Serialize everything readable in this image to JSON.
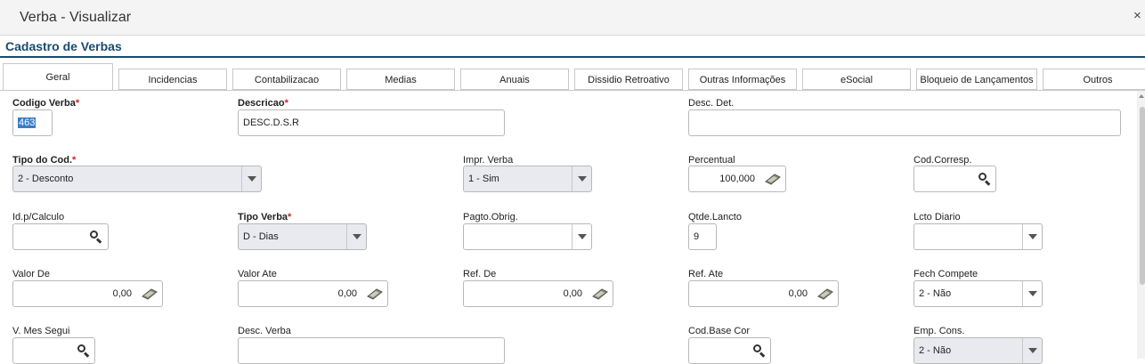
{
  "window": {
    "title": "Verba - Visualizar",
    "close_glyph": "×"
  },
  "form_title": "Cadastro de Verbas",
  "tabs": [
    "Geral",
    "Incidencias",
    "Contabilizacao",
    "Medias",
    "Anuais",
    "Dissidio Retroativo",
    "Outras Informações",
    "eSocial",
    "Bloqueio de Lançamentos",
    "Outros"
  ],
  "required_mark": "*",
  "fields": {
    "codigo_verba": {
      "label": "Codigo Verba",
      "value": "463"
    },
    "descricao": {
      "label": "Descricao",
      "value": "DESC.D.S.R"
    },
    "desc_det": {
      "label": "Desc. Det.",
      "value": ""
    },
    "tipo_cod": {
      "label": "Tipo do Cod.",
      "value": "2 - Desconto"
    },
    "impr_verba": {
      "label": "Impr. Verba",
      "value": "1 - Sim"
    },
    "percentual": {
      "label": "Percentual",
      "value": "100,000"
    },
    "cod_corresp": {
      "label": "Cod.Corresp.",
      "value": ""
    },
    "id_calculo": {
      "label": "Id.p/Calculo",
      "value": ""
    },
    "tipo_verba": {
      "label": "Tipo Verba",
      "value": "D - Dias"
    },
    "pagto_obrig": {
      "label": "Pagto.Obrig.",
      "value": ""
    },
    "qtde_lancto": {
      "label": "Qtde.Lancto",
      "value": "9"
    },
    "lcto_diario": {
      "label": "Lcto Diario",
      "value": ""
    },
    "valor_de": {
      "label": "Valor De",
      "value": "0,00"
    },
    "valor_ate": {
      "label": "Valor Ate",
      "value": "0,00"
    },
    "ref_de": {
      "label": "Ref. De",
      "value": "0,00"
    },
    "ref_ate": {
      "label": "Ref. Ate",
      "value": "0,00"
    },
    "fech_compete": {
      "label": "Fech Compete",
      "value": "2 - Não"
    },
    "v_mes_segui": {
      "label": "V. Mes Segui",
      "value": ""
    },
    "desc_verba": {
      "label": "Desc. Verba",
      "value": ""
    },
    "cod_base_cor": {
      "label": "Cod.Base Cor",
      "value": ""
    },
    "emp_cons": {
      "label": "Emp. Cons.",
      "value": "2 - Não"
    }
  },
  "icons": {
    "lookup": "search-icon",
    "calculator": "calculator-icon",
    "dropdown": "chevron-down-icon"
  }
}
